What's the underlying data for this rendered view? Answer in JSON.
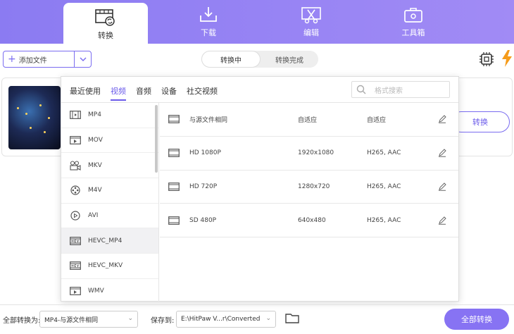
{
  "nav": {
    "tabs": [
      {
        "label": "转换",
        "icon": "film-convert-icon",
        "active": true
      },
      {
        "label": "下载",
        "icon": "download-icon",
        "active": false
      },
      {
        "label": "编辑",
        "icon": "edit-scissors-icon",
        "active": false
      },
      {
        "label": "工具箱",
        "icon": "toolbox-icon",
        "active": false
      }
    ]
  },
  "toolbar": {
    "add_file_label": "添加文件",
    "segments": [
      "转换中",
      "转换完成"
    ],
    "active_segment": 0
  },
  "file_card": {
    "convert_label": "转换"
  },
  "format_panel": {
    "tabs": [
      "最近使用",
      "视频",
      "音频",
      "设备",
      "社交视频"
    ],
    "active_tab": 1,
    "search_placeholder": "格式搜索",
    "formats": [
      {
        "label": "MP4",
        "icon": "film-icon"
      },
      {
        "label": "MOV",
        "icon": "play-box-icon"
      },
      {
        "label": "MKV",
        "icon": "camera-reel-icon"
      },
      {
        "label": "M4V",
        "icon": "film-reel-icon"
      },
      {
        "label": "AVI",
        "icon": "play-circle-icon"
      },
      {
        "label": "HEVC_MP4",
        "icon": "hevc-icon"
      },
      {
        "label": "HEVC_MKV",
        "icon": "hevc-icon"
      },
      {
        "label": "WMV",
        "icon": "play-box-icon"
      }
    ],
    "selected_format": 5,
    "presets": [
      {
        "name": "与源文件相同",
        "resolution": "自适应",
        "codec": "自适应"
      },
      {
        "name": "HD 1080P",
        "resolution": "1920x1080",
        "codec": "H265, AAC"
      },
      {
        "name": "HD 720P",
        "resolution": "1280x720",
        "codec": "H265, AAC"
      },
      {
        "name": "SD 480P",
        "resolution": "640x480",
        "codec": "H265, AAC"
      }
    ]
  },
  "bottom": {
    "convert_all_to_label": "全部转换为:",
    "format_value": "MP4-与源文件相同",
    "save_to_label": "保存到:",
    "save_path": "E:\\HitPaw V...r\\Converted",
    "convert_all_button": "全部转换"
  },
  "colors": {
    "accent": "#7a6cf0",
    "nav_bg": "#9583f4"
  }
}
